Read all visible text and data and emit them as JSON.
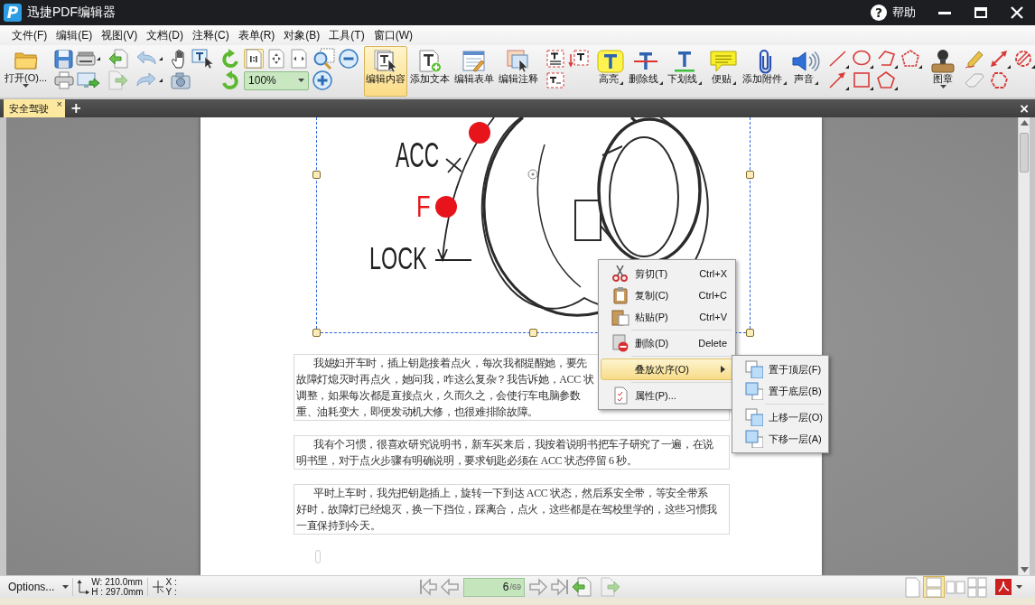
{
  "window": {
    "logo": "P",
    "title": "迅捷PDF编辑器",
    "help_glyph": "?",
    "help_label": "帮助"
  },
  "menu_bar": [
    "文件(F)",
    "编辑(E)",
    "视图(V)",
    "文档(D)",
    "注释(C)",
    "表单(R)",
    "对象(B)",
    "工具(T)",
    "窗口(W)"
  ],
  "toolbar": {
    "open_button": {
      "label": "打开(O)..."
    },
    "fit_buttons": [
      {
        "selected": true
      },
      {
        "selected": false
      },
      {
        "selected": false
      }
    ],
    "zoom_field": {
      "value": "100%"
    },
    "edit_tools": [
      {
        "label": "编辑内容",
        "selected": true
      },
      {
        "label": "添加文本",
        "selected": false
      },
      {
        "label": "编辑表单",
        "selected": false
      },
      {
        "label": "编辑注释",
        "selected": false
      }
    ],
    "markup_tools": [
      {
        "label": "高亮"
      },
      {
        "label": "删除线"
      },
      {
        "label": "下划线"
      }
    ],
    "attach_tools": [
      {
        "label": "便贴"
      },
      {
        "label": "添加附件"
      },
      {
        "label": "声音"
      }
    ],
    "stamp_button": {
      "label": "图章"
    }
  },
  "document_tabs": {
    "tabs": [
      {
        "label": "安全驾驶",
        "selected": true,
        "close_glyph": "×"
      }
    ],
    "new_tab_glyph": "+",
    "close_glyph": "×"
  },
  "page": {
    "image": {
      "labels": [
        "ACC",
        "F",
        "LOCK"
      ],
      "selected": true
    },
    "paragraphs": [
      {
        "lines": [
          "我媳妇开车时，插上钥匙接着点火，每次我都提醒她，要先",
          "故障灯熄灭时再点火，她问我，咋这么复杂？我告诉她，ACC 状",
          "调整，如果每次都是直接点火，久而久之，会使行车电脑参数",
          "重、油耗变大，即便发动机大修，也很难排除故障。"
        ]
      },
      {
        "lines": [
          "我有个习惯，很喜欢研究说明书，新车买来后，我按着说明书把车子研究了一遍，在说",
          "明书里，对于点火步骤有明确说明，要求钥匙必须在 ACC 状态停留 6 秒。"
        ]
      },
      {
        "lines": [
          "平时上车时，我先把钥匙插上，旋转一下到达 ACC 状态，然后系安全带，等安全带系",
          "好时，故障灯已经熄灭，换一下挡位，踩离合，点火，这些都是在驾校里学的，这些习惯我",
          "一直保持到今天。"
        ]
      }
    ]
  },
  "context_menu": {
    "items": [
      {
        "kind": "command",
        "label": "剪切(T)",
        "shortcut": "Ctrl+X",
        "selected": false
      },
      {
        "kind": "command",
        "label": "复制(C)",
        "shortcut": "Ctrl+C",
        "selected": false
      },
      {
        "kind": "command",
        "label": "粘贴(P)",
        "shortcut": "Ctrl+V",
        "selected": false
      },
      {
        "kind": "separator"
      },
      {
        "kind": "command",
        "label": "删除(D)",
        "shortcut": "Delete",
        "selected": false
      },
      {
        "kind": "separator"
      },
      {
        "kind": "submenu",
        "label": "叠放次序(O)",
        "selected": true
      },
      {
        "kind": "separator"
      },
      {
        "kind": "command",
        "label": "属性(P)...",
        "selected": false
      }
    ]
  },
  "submenu": {
    "items": [
      {
        "kind": "command",
        "label": "置于顶层(F)",
        "selected": false
      },
      {
        "kind": "command",
        "label": "置于底层(B)",
        "selected": false
      },
      {
        "kind": "separator"
      },
      {
        "kind": "command",
        "label": "上移一层(O)",
        "selected": false
      },
      {
        "kind": "command",
        "label": "下移一层(A)",
        "selected": false
      }
    ]
  },
  "status_bar": {
    "options_label": "Options...",
    "page_width": "W: 210.0mm",
    "page_height": "H : 297.0mm",
    "cursor_x": "X :",
    "cursor_y": "Y :",
    "page_number": "6",
    "page_total": "/69",
    "view_modes": [
      {
        "selected": false
      },
      {
        "selected": true
      },
      {
        "selected": false
      },
      {
        "selected": false
      }
    ]
  }
}
